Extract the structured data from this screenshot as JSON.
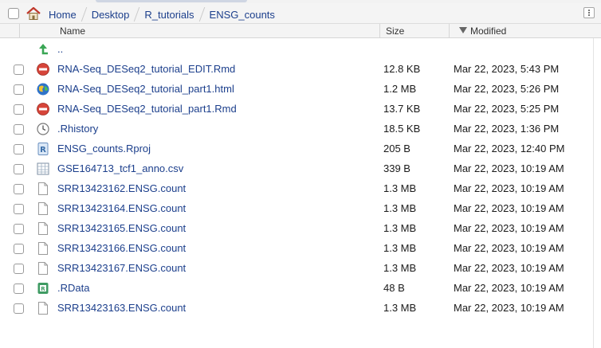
{
  "breadcrumb": {
    "items": [
      "Home",
      "Desktop",
      "R_tutorials",
      "ENSG_counts"
    ]
  },
  "columns": {
    "name": "Name",
    "size": "Size",
    "modified": "Modified"
  },
  "parent_row": {
    "label": ".."
  },
  "files": [
    {
      "name": "RNA-Seq_DESeq2_tutorial_EDIT.Rmd",
      "size": "12.8 KB",
      "modified": "Mar 22, 2023, 5:43 PM",
      "icon": "rmd-icon"
    },
    {
      "name": "RNA-Seq_DESeq2_tutorial_part1.html",
      "size": "1.2 MB",
      "modified": "Mar 22, 2023, 5:26 PM",
      "icon": "html-icon"
    },
    {
      "name": "RNA-Seq_DESeq2_tutorial_part1.Rmd",
      "size": "13.7 KB",
      "modified": "Mar 22, 2023, 5:25 PM",
      "icon": "rmd-icon"
    },
    {
      "name": ".Rhistory",
      "size": "18.5 KB",
      "modified": "Mar 22, 2023, 1:36 PM",
      "icon": "history-icon"
    },
    {
      "name": "ENSG_counts.Rproj",
      "size": "205 B",
      "modified": "Mar 22, 2023, 12:40 PM",
      "icon": "rproj-icon"
    },
    {
      "name": "GSE164713_tcf1_anno.csv",
      "size": "339 B",
      "modified": "Mar 22, 2023, 10:19 AM",
      "icon": "csv-icon"
    },
    {
      "name": "SRR13423162.ENSG.count",
      "size": "1.3 MB",
      "modified": "Mar 22, 2023, 10:19 AM",
      "icon": "file-icon"
    },
    {
      "name": "SRR13423164.ENSG.count",
      "size": "1.3 MB",
      "modified": "Mar 22, 2023, 10:19 AM",
      "icon": "file-icon"
    },
    {
      "name": "SRR13423165.ENSG.count",
      "size": "1.3 MB",
      "modified": "Mar 22, 2023, 10:19 AM",
      "icon": "file-icon"
    },
    {
      "name": "SRR13423166.ENSG.count",
      "size": "1.3 MB",
      "modified": "Mar 22, 2023, 10:19 AM",
      "icon": "file-icon"
    },
    {
      "name": "SRR13423167.ENSG.count",
      "size": "1.3 MB",
      "modified": "Mar 22, 2023, 10:19 AM",
      "icon": "file-icon"
    },
    {
      "name": ".RData",
      "size": "48 B",
      "modified": "Mar 22, 2023, 10:19 AM",
      "icon": "rdata-icon"
    },
    {
      "name": "SRR13423163.ENSG.count",
      "size": "1.3 MB",
      "modified": "Mar 22, 2023, 10:19 AM",
      "icon": "file-icon"
    }
  ],
  "colors": {
    "link": "#1c3f8c",
    "header_bg": "#f4f4f4",
    "up_arrow": "#3aa655",
    "rmd_red": "#d6453a"
  }
}
